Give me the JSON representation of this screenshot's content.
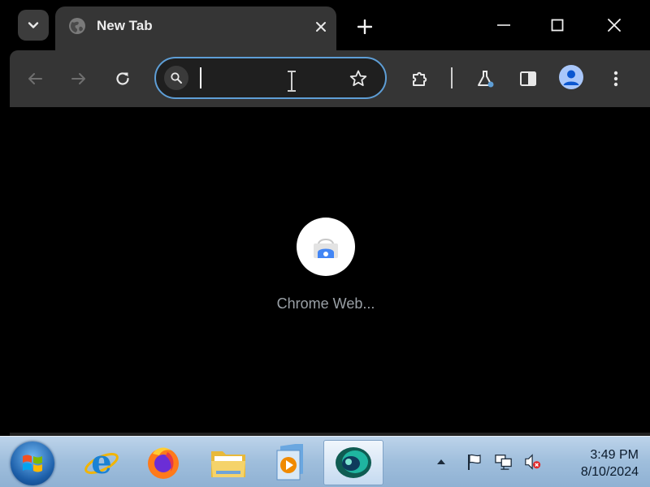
{
  "browser": {
    "tab": {
      "title": "New Tab"
    },
    "omnibox": {
      "value": "",
      "placeholder": ""
    }
  },
  "content": {
    "shortcut": {
      "label": "Chrome Web..."
    }
  },
  "taskbar": {
    "apps": [
      "internet-explorer",
      "firefox",
      "file-explorer",
      "media-player",
      "chromium-app"
    ],
    "clock": {
      "time": "3:49 PM",
      "date": "8/10/2024"
    }
  },
  "colors": {
    "tab_active": "#353535",
    "omnibox_border": "#5e9ed6",
    "shortcut_label": "#9aa0a6",
    "avatar_bg": "#a9c7fa"
  }
}
